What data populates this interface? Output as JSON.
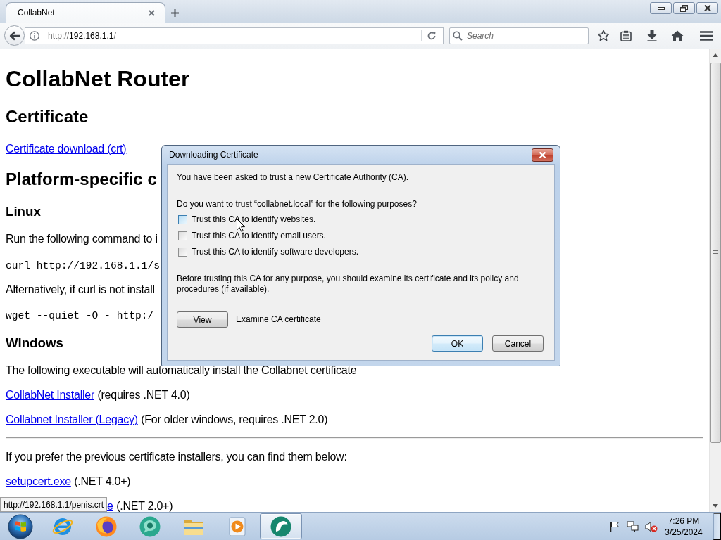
{
  "browser": {
    "tabs": [
      {
        "title": "CollabNet",
        "selected": true
      }
    ],
    "address_bar": {
      "scheme": "http://",
      "host": "192.168.1.1",
      "path": "/"
    },
    "search": {
      "placeholder": "Search"
    },
    "status_tooltip": "http://192.168.1.1/penis.crt"
  },
  "page": {
    "blocks": [
      {
        "kind": "h1",
        "text": "CollabNet Router"
      },
      {
        "kind": "h2",
        "text": "Certificate"
      },
      {
        "kind": "link",
        "link": "Certificate download (crt)"
      },
      {
        "kind": "h2",
        "text": "Platform-specific c"
      },
      {
        "kind": "h3",
        "text": "Linux"
      },
      {
        "kind": "text",
        "text": "Run the following command to i"
      },
      {
        "kind": "code",
        "text": "curl http://192.168.1.1/s"
      },
      {
        "kind": "text",
        "text": "Alternatively, if curl is not install"
      },
      {
        "kind": "code",
        "text": "wget --quiet -O - http:/"
      },
      {
        "kind": "h3",
        "text": "Windows"
      },
      {
        "kind": "text",
        "text": "The following executable will automatically install the Collabnet certificate"
      },
      {
        "kind": "link",
        "link": "CollabNet Installer",
        "note": "(requires .NET 4.0)"
      },
      {
        "kind": "link",
        "link": "Collabnet Installer (Legacy)",
        "note": "(For older windows, requires .NET 2.0)"
      },
      {
        "kind": "rule"
      },
      {
        "kind": "text",
        "text": "If you prefer the previous certificate installers, you can find them below:"
      },
      {
        "kind": "link",
        "link": "setupcert.exe",
        "note": "(.NET 4.0+)"
      },
      {
        "kind": "link",
        "link": "e",
        "note": "(.NET 2.0+)"
      }
    ]
  },
  "dialog": {
    "title": "Downloading Certificate",
    "intro": "You have been asked to trust a new Certificate Authority (CA).",
    "question": "Do you want to trust “collabnet.local” for the following purposes?",
    "options": [
      {
        "label": "Trust this CA to identify websites.",
        "checked": false,
        "hovered": true
      },
      {
        "label": "Trust this CA to identify email users.",
        "checked": false,
        "hovered": false
      },
      {
        "label": "Trust this CA to identify software developers.",
        "checked": false,
        "hovered": false
      }
    ],
    "advice": "Before trusting this CA for any purpose, you should examine its certificate and its policy and procedures (if available).",
    "view_button": "View",
    "view_caption": "Examine CA certificate",
    "buttons": [
      {
        "label": "OK",
        "focused": true
      },
      {
        "label": "Cancel",
        "focused": false
      }
    ]
  },
  "taskbar": {
    "apps": [
      {
        "kind": "ring",
        "selected": false
      },
      {
        "kind": "flame",
        "selected": false
      },
      {
        "kind": "bubble",
        "selected": false
      },
      {
        "kind": "folder",
        "selected": false
      },
      {
        "kind": "player",
        "selected": false
      },
      {
        "kind": "bird",
        "selected": true
      }
    ],
    "tray": {
      "volume_muted": true,
      "time": "7:26 PM",
      "date": "3/25/2024"
    }
  }
}
